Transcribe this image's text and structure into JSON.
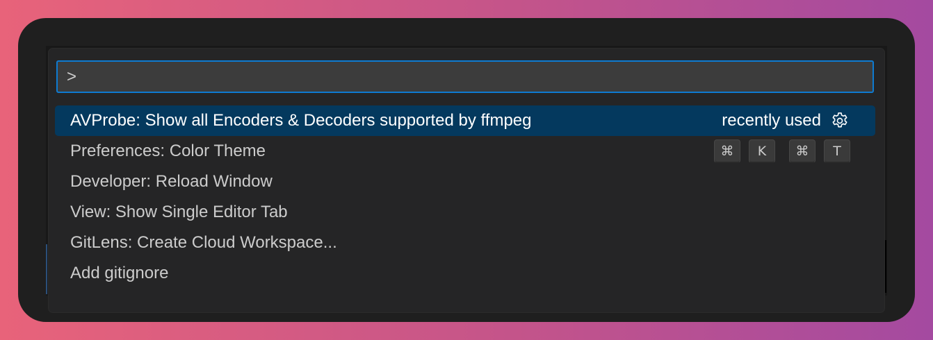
{
  "command_palette": {
    "query": ">",
    "placeholder": "",
    "items": [
      {
        "label": "AVProbe: Show all Encoders & Decoders supported by ffmpeg",
        "detail": "recently used",
        "icon": "gear-icon",
        "selected": true
      },
      {
        "label": "Preferences: Color Theme",
        "keybinding": [
          [
            "⌘",
            "K"
          ],
          [
            "⌘",
            "T"
          ]
        ]
      },
      {
        "label": "Developer: Reload Window"
      },
      {
        "label": "View: Show Single Editor Tab"
      },
      {
        "label": "GitLens: Create Cloud Workspace..."
      },
      {
        "label": "Add gitignore"
      }
    ]
  },
  "colors": {
    "selection_background": "#04395e",
    "focus_border": "#0e7bd2",
    "palette_background": "#252526",
    "input_background": "#3c3c3c"
  }
}
